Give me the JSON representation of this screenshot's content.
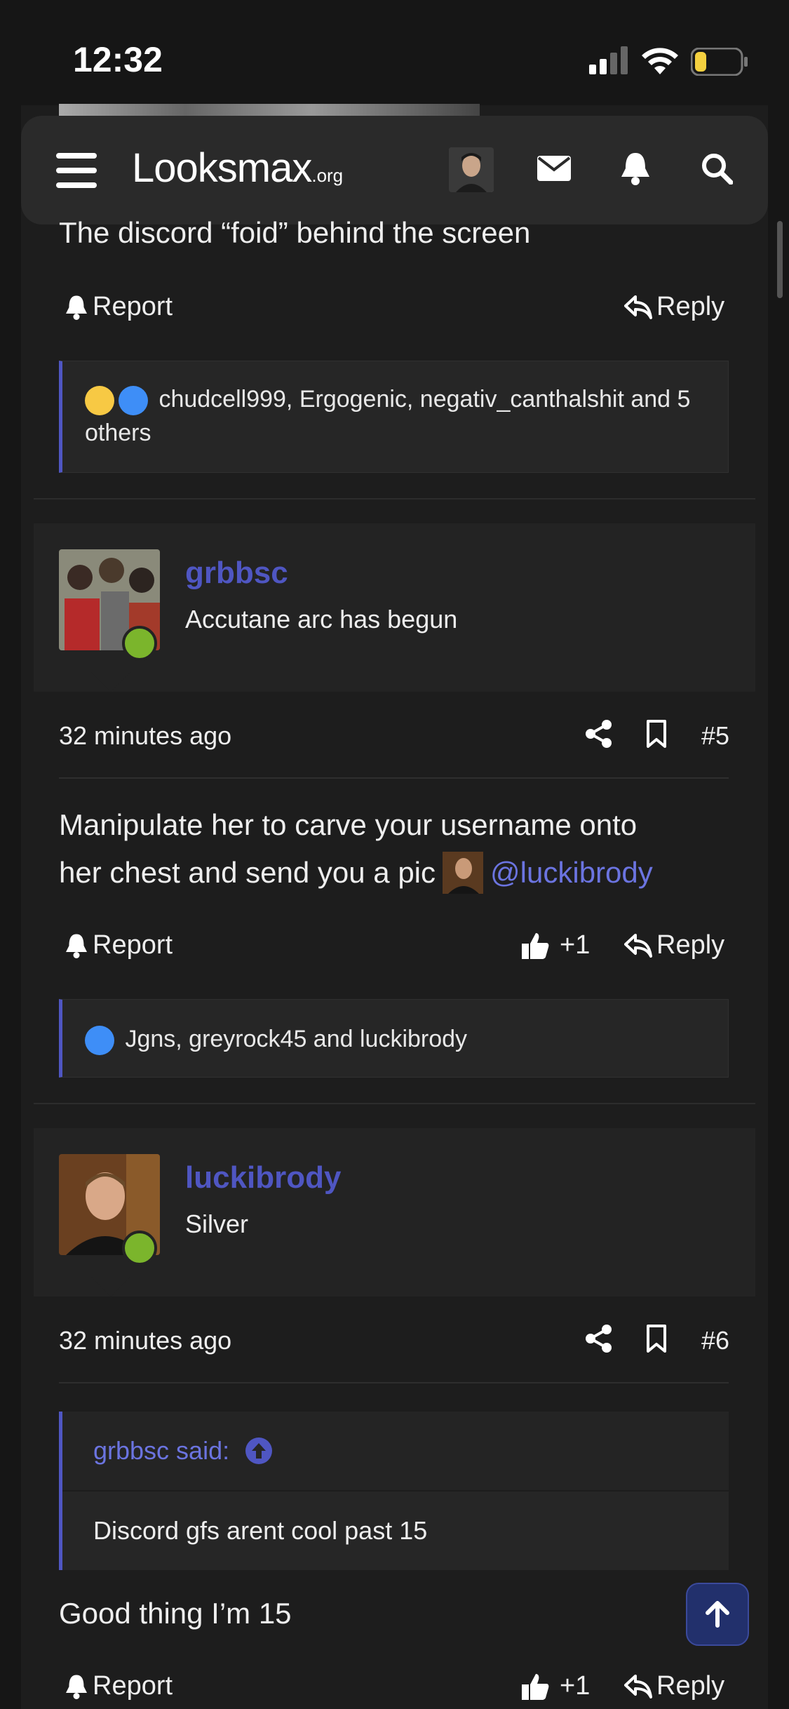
{
  "status_bar": {
    "time": "12:32"
  },
  "header": {
    "logo_main": "Looksmax",
    "logo_suffix": ".org"
  },
  "post4": {
    "body_tail": "The discord “foid” behind the screen",
    "report_label": "Report",
    "reply_label": "Reply",
    "reactions_text": "chudcell999, Ergogenic, negativ_canthalshit and 5 others"
  },
  "post5": {
    "username": "grbbsc",
    "user_title": "Accutane arc has begun",
    "time": "32 minutes ago",
    "number": "#5",
    "body_line1": "Manipulate her to carve your username onto",
    "body_line2": "her chest and send you a pic",
    "mention": "@luckibrody",
    "report_label": "Report",
    "like_count": "+1",
    "reply_label": "Reply",
    "reactions_text": "Jgns, greyrock45 and luckibrody"
  },
  "post6": {
    "username": "luckibrody",
    "user_title": "Silver",
    "time": "32 minutes ago",
    "number": "#6",
    "quote_author": "grbbsc said:",
    "quote_text": "Discord gfs arent cool past 15",
    "body": "Good thing I’m 15",
    "report_label": "Report",
    "like_count": "+1",
    "reply_label": "Reply"
  },
  "colors": {
    "accent": "#4f56c2",
    "online": "#7bb52c",
    "background": "#1d1d1d"
  },
  "icons": [
    "menu-icon",
    "mail-icon",
    "bell-icon",
    "search-icon",
    "share-icon",
    "bookmark-icon",
    "reply-icon",
    "thumbs-up-icon",
    "arrow-up-icon"
  ]
}
